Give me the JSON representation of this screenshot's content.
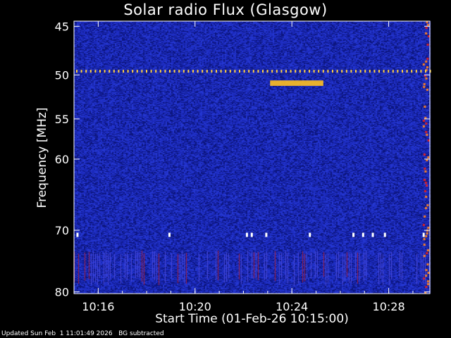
{
  "chart_data": {
    "type": "heatmap",
    "title": "Solar radio Flux (Glasgow)",
    "xlabel": "Start Time (01-Feb-26 10:15:00)",
    "ylabel": "Frequency [MHz]",
    "y_ticks": [
      45,
      50,
      55,
      60,
      70,
      80
    ],
    "y_tick_labels": [
      "45",
      "50",
      "55",
      "60",
      "70",
      "80"
    ],
    "x_ticks": [
      "10:16",
      "10:20",
      "10:24",
      "10:28"
    ],
    "x_tick_minutes": [
      16,
      20,
      24,
      28
    ],
    "x_range_minutes": [
      15,
      29.7
    ],
    "y_range_mhz": [
      44.5,
      80.3
    ],
    "colorscale": [
      "#000030",
      "#0a0a8c",
      "#1c2ad8",
      "#c01010",
      "#ff9a00",
      "#ffff60",
      "#ffffff"
    ],
    "background_color": "#14209a",
    "features": [
      {
        "kind": "interference-line",
        "mhz": 49.6,
        "color": "#ffd040"
      },
      {
        "kind": "burst",
        "mhz_from": 50.6,
        "mhz_to": 51.2,
        "minute_from": 23.1,
        "minute_to": 25.3,
        "color": "#ffc020"
      },
      {
        "kind": "interference-dots",
        "mhz": 70.7,
        "minutes": [
          15.1,
          18.9,
          22.1,
          22.3,
          22.9,
          24.7,
          26.5,
          26.9,
          27.3,
          27.8,
          29.4
        ],
        "color": "#ffffff"
      },
      {
        "kind": "band",
        "mhz_from": 73.1,
        "mhz_to": 78.3,
        "color": "#4848d8"
      },
      {
        "kind": "edge-emission",
        "minute_from": 29.4,
        "minute_to": 29.7,
        "color": "#e02020"
      }
    ]
  },
  "footer": "Updated Sun Feb  1 11:01:49 2026   BG subtracted"
}
